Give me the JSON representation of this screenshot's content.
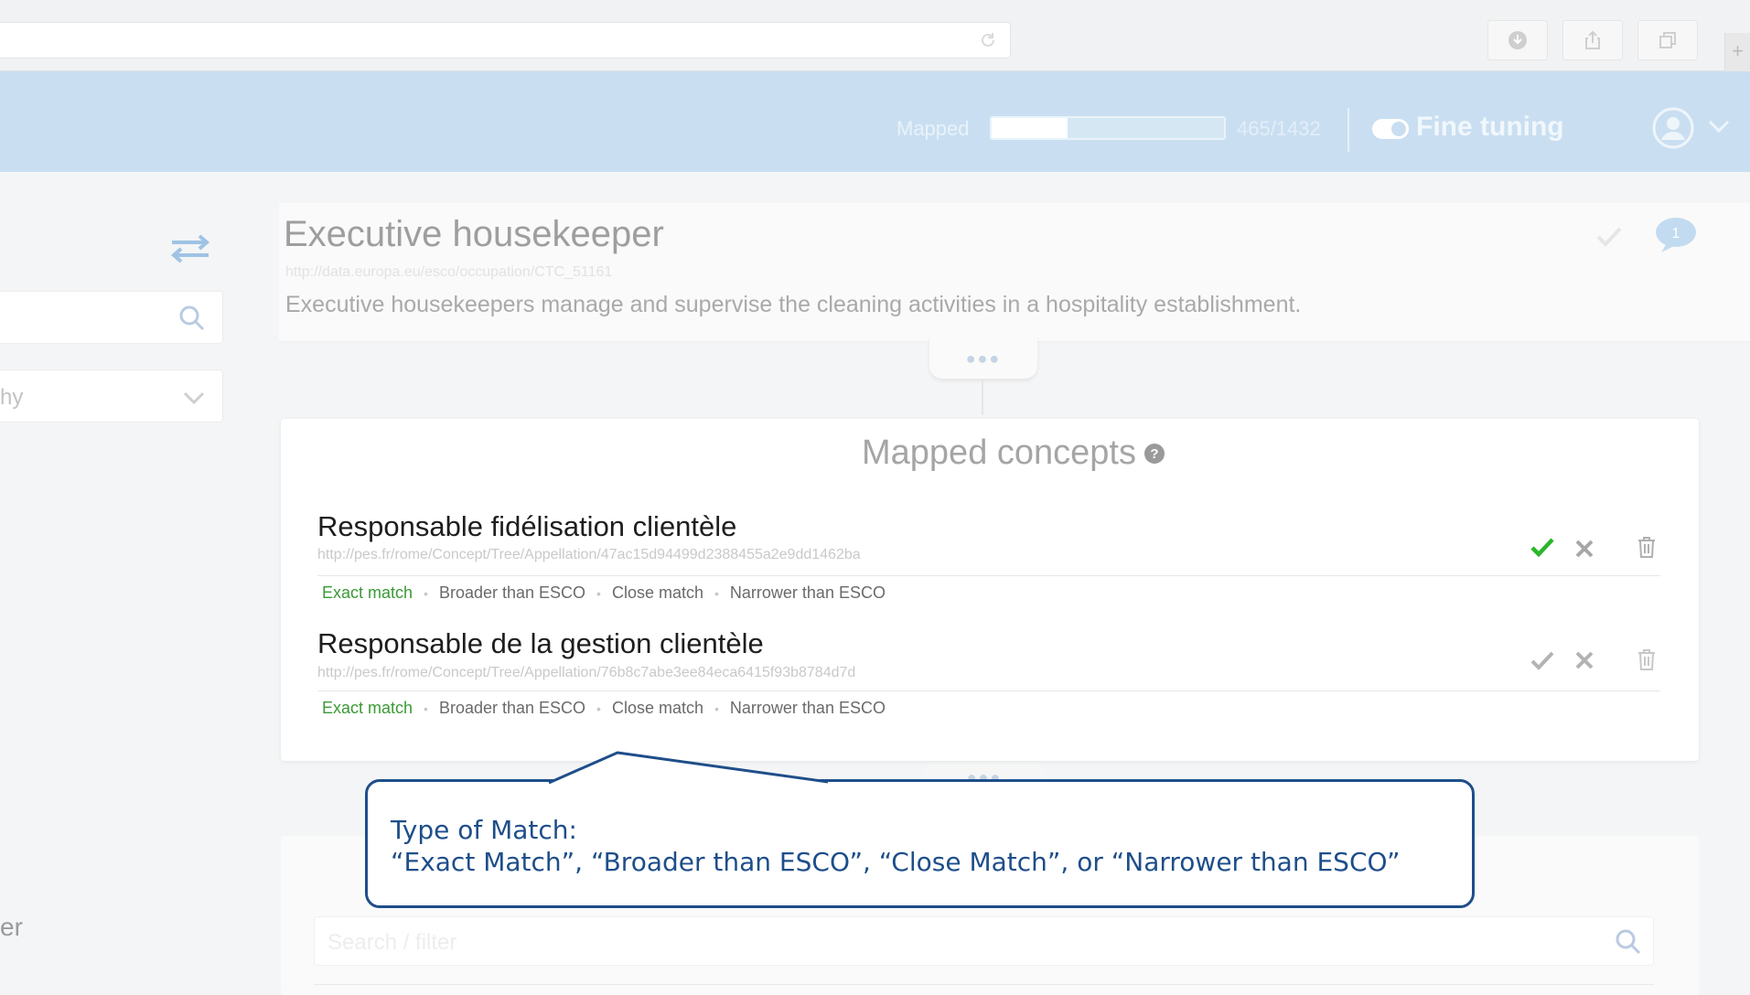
{
  "header": {
    "mapped_label": "Mapped",
    "progress_count": "465/1432",
    "progress_fraction": 0.325,
    "fine_tuning_label": "Fine tuning"
  },
  "sidebar": {
    "select_value": "hy",
    "bottom_text": "er"
  },
  "occupation": {
    "title": "Executive housekeeper",
    "uri": "http://data.europa.eu/esco/occupation/CTC_51161",
    "description": "Executive housekeepers manage and supervise the cleaning activities in a hospitality establishment."
  },
  "mapped_concepts": {
    "title": "Mapped concepts",
    "items": [
      {
        "name": "Responsable fidélisation clientèle",
        "uri": "http://pes.fr/rome/Concept/Tree/Appellation/47ac15d94499d2388455a2e9dd1462ba",
        "validated": true
      },
      {
        "name": "Responsable de la gestion clientèle",
        "uri": "http://pes.fr/rome/Concept/Tree/Appellation/76b8c7abe3ee84eca6415f93b8784d7d",
        "validated": false
      }
    ],
    "match_types": [
      "Exact match",
      "Broader than ESCO",
      "Close match",
      "Narrower than ESCO"
    ],
    "selected_match": "Exact match"
  },
  "filter": {
    "placeholder": "Search / filter"
  },
  "callout": {
    "line1": "Type of Match:",
    "line2": "“Exact Match”, “Broader than ESCO”, “Close Match”, or “Narrower than ESCO”"
  },
  "colors": {
    "header_bg": "#c9dff1",
    "accent_green": "#2bb52b",
    "callout_blue": "#1e4e8a"
  },
  "icons": [
    "reload-icon",
    "download-icon",
    "share-icon",
    "duplicate-icon",
    "user-icon",
    "chevron-down-icon",
    "swap-icon",
    "search-icon",
    "check-icon",
    "comment-icon",
    "help-icon",
    "close-icon",
    "trash-icon"
  ]
}
